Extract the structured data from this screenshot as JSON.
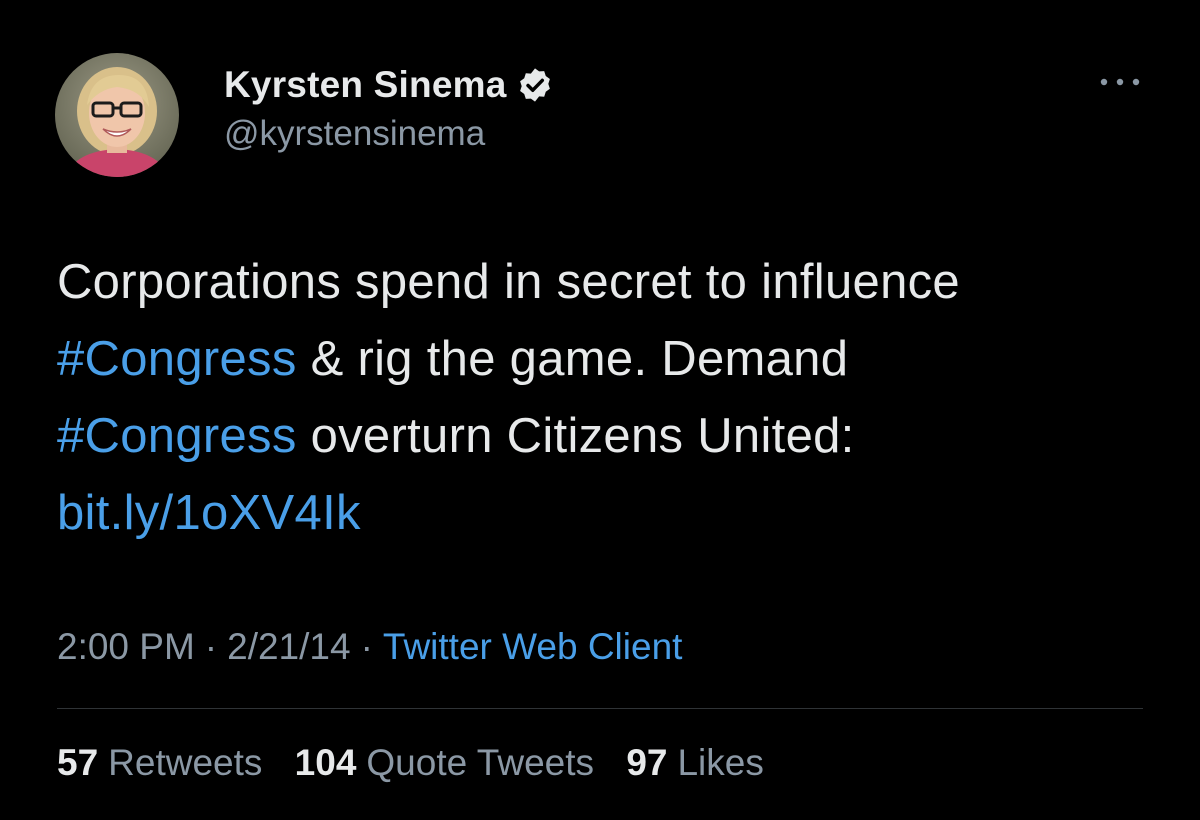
{
  "author": {
    "name": "Kyrsten Sinema",
    "handle": "@kyrstensinema",
    "verified": true,
    "avatar_icon": "profile-photo"
  },
  "more_icon": "more-horizontal-icon",
  "tweet": {
    "lines": [
      [
        {
          "text": "Corporations spend in secret to influence",
          "link": false
        }
      ],
      [
        {
          "text": "#Congress",
          "link": true
        },
        {
          "text": " & rig the game. Demand",
          "link": false
        }
      ],
      [
        {
          "text": "#Congress",
          "link": true
        },
        {
          "text": " overturn Citizens United:",
          "link": false
        }
      ],
      [
        {
          "text": "bit.ly/1oXV4Ik",
          "link": true
        }
      ]
    ]
  },
  "meta": {
    "time": "2:00 PM",
    "separator": "·",
    "date": "2/21/14",
    "source": "Twitter Web Client"
  },
  "stats": {
    "retweets": {
      "count": "57",
      "label": "Retweets"
    },
    "quotes": {
      "count": "104",
      "label": "Quote Tweets"
    },
    "likes": {
      "count": "97",
      "label": "Likes"
    }
  },
  "colors": {
    "background": "#000000",
    "text": "#e7e9ea",
    "muted": "#8b98a5",
    "link": "#4a9fe8",
    "divider": "#2f3336"
  }
}
